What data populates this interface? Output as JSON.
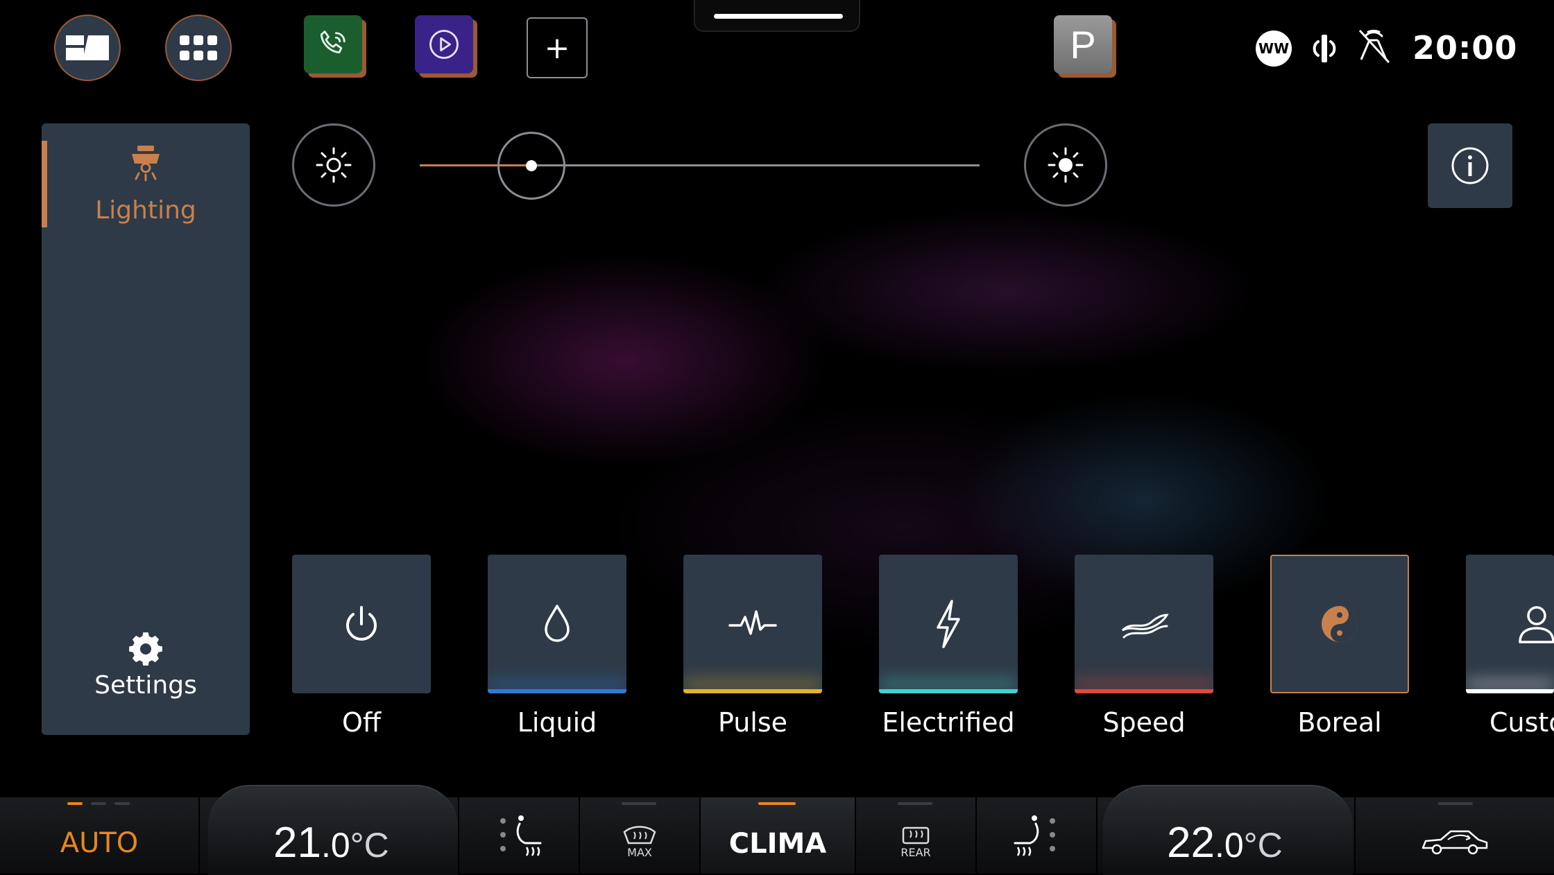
{
  "top_bar": {
    "apps": [
      {
        "name": "phone",
        "icon": "phone-icon"
      },
      {
        "name": "media",
        "icon": "play-icon"
      }
    ],
    "add_label": "+",
    "gear_label": "P",
    "status_icons": [
      "ww-icon",
      "wireless-charging-icon",
      "no-location-icon"
    ],
    "ww_label": "WW",
    "time": "20:00"
  },
  "sidebar": {
    "items": [
      {
        "label": "Lighting",
        "icon": "lamp-icon",
        "selected": true
      },
      {
        "label": "Settings",
        "icon": "gear-icon",
        "selected": false
      }
    ]
  },
  "brightness": {
    "level": 0.2,
    "min_icon": "brightness-low-icon",
    "max_icon": "brightness-high-icon"
  },
  "info_icon": "info-icon",
  "modes": [
    {
      "label": "Off",
      "icon": "power-icon",
      "glow": "none"
    },
    {
      "label": "Liquid",
      "icon": "drop-icon",
      "glow": "#2e7bd6"
    },
    {
      "label": "Pulse",
      "icon": "pulse-icon",
      "glow": "#e3b32a"
    },
    {
      "label": "Electrified",
      "icon": "bolt-icon",
      "glow": "#3fd4c9"
    },
    {
      "label": "Speed",
      "icon": "wind-icon",
      "glow": "#e04a3a"
    },
    {
      "label": "Boreal",
      "icon": "yin-yang-icon",
      "glow": "none",
      "selected": true
    },
    {
      "label": "Custo",
      "icon": "person-icon",
      "glow": "#ffffff"
    }
  ],
  "climate": {
    "auto_label": "AUTO",
    "left_temp": {
      "whole": "21",
      "decimal": ".0",
      "unit": "°C"
    },
    "right_temp": {
      "whole": "22",
      "decimal": ".0",
      "unit": "°C"
    },
    "max_label": "MAX",
    "clima_label": "CLIMA",
    "rear_label": "REAR",
    "accent": "#e8861e"
  }
}
